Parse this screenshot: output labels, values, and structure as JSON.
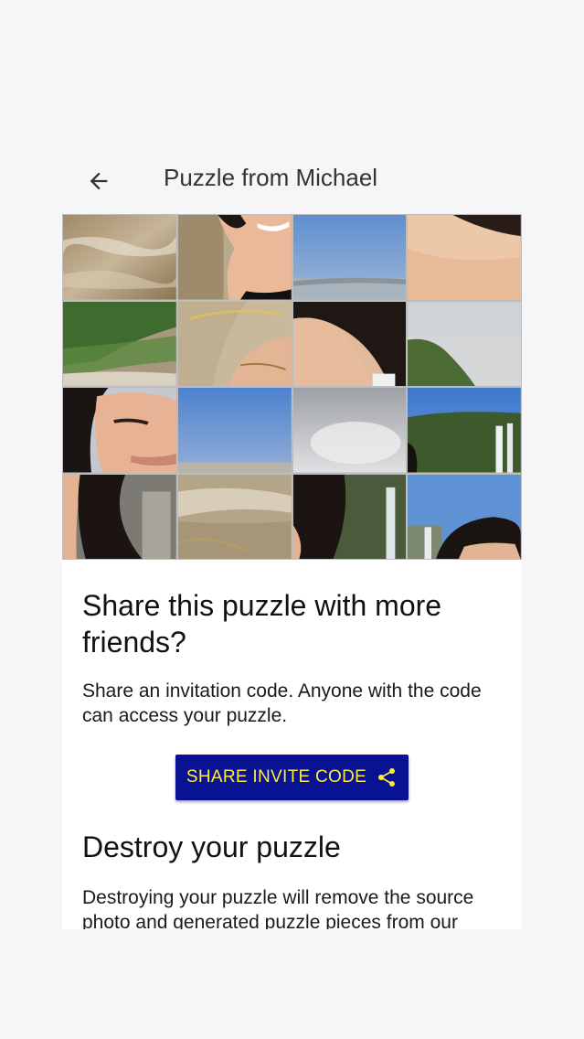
{
  "header": {
    "title": "Puzzle from Michael",
    "back_icon": "arrow-back-icon"
  },
  "puzzle": {
    "rows": 4,
    "cols": 4
  },
  "share_section": {
    "heading": "Share this puzzle with more friends?",
    "description": "Share an invitation code. Anyone with the code can access your puzzle.",
    "button_label": "SHARE INVITE CODE",
    "button_icon": "share-icon",
    "button_bg": "#0a1294",
    "button_fg": "#ffeb3b"
  },
  "destroy_section": {
    "heading": "Destroy your puzzle",
    "description": "Destroying your puzzle will remove the source photo and generated puzzle pieces from our"
  }
}
